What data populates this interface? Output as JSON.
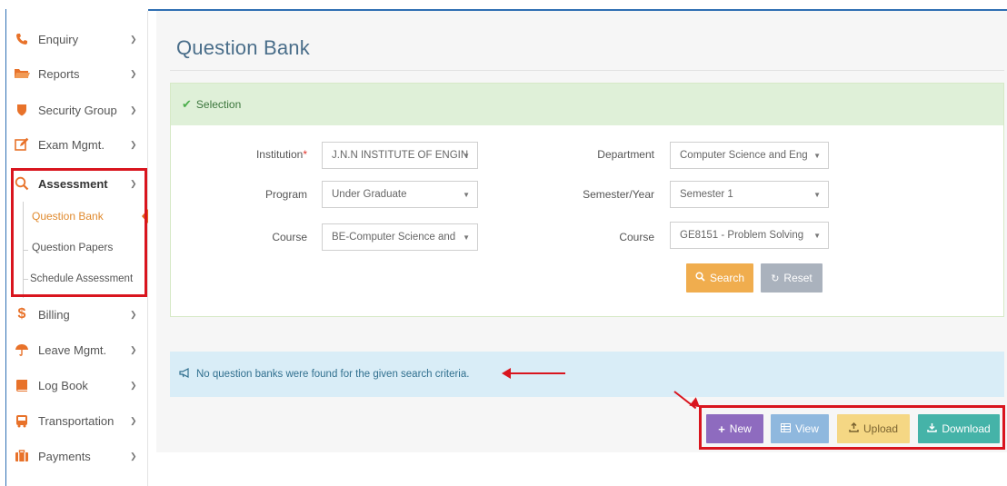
{
  "sidebar": {
    "items": [
      {
        "label": "Enquiry",
        "icon": "phone-icon"
      },
      {
        "label": "Reports",
        "icon": "folder-icon"
      },
      {
        "label": "Security Group",
        "icon": "shield-icon"
      },
      {
        "label": "Exam Mgmt.",
        "icon": "edit-icon"
      },
      {
        "label": "Assessment",
        "icon": "search-icon"
      },
      {
        "label": "Billing",
        "icon": "dollar-icon"
      },
      {
        "label": "Leave Mgmt.",
        "icon": "umbrella-icon"
      },
      {
        "label": "Log Book",
        "icon": "book-icon"
      },
      {
        "label": "Transportation",
        "icon": "bus-icon"
      },
      {
        "label": "Payments",
        "icon": "briefcase-icon"
      }
    ],
    "assessment_sub": [
      "Question Bank",
      "Question Papers",
      "Schedule Assessment"
    ]
  },
  "page": {
    "title": "Question Bank"
  },
  "panel": {
    "heading": "Selection",
    "fields": {
      "institution_label": "Institution",
      "institution_required": "*",
      "institution_value": "J.N.N INSTITUTE OF ENGIN",
      "department_label": "Department",
      "department_value": "Computer Science and Eng",
      "program_label": "Program",
      "program_value": "Under Graduate",
      "semester_label": "Semester/Year",
      "semester_value": "Semester 1",
      "course_label": "Course",
      "course_value": "BE-Computer Science and",
      "course2_label": "Course",
      "course2_value": "GE8151 - Problem Solving"
    },
    "search_label": "Search",
    "reset_label": "Reset"
  },
  "info": {
    "message": "No question banks were found for the given search criteria."
  },
  "actions": {
    "new": "New",
    "view": "View",
    "upload": "Upload",
    "download": "Download"
  },
  "colors": {
    "accent_orange": "#f0ad4e",
    "new_purple": "#8e6bbf",
    "view_blue": "#8fb8de",
    "upload_yellow": "#f5d784",
    "download_teal": "#45b3a8",
    "annotation_red": "#d9151e"
  }
}
